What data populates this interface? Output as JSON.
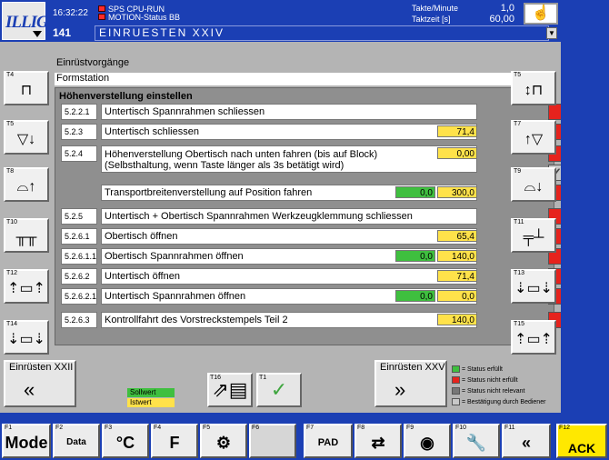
{
  "header": {
    "logo": "ILLIG",
    "time": "16:32:22",
    "sps_label": "SPS CPU-RUN",
    "motion_label": "MOTION-Status BB",
    "takte_label": "Takte/Minute",
    "takte_value": "1,0",
    "taktzeit_label": "Taktzeit [s]",
    "taktzeit_value": "60,00",
    "step_number": "141",
    "step_title": "EINRUESTEN XXIV"
  },
  "main": {
    "title": "Einrüstvorgänge",
    "section": "Formstation",
    "panel_title": "Höhenverstellung einstellen",
    "rows": [
      {
        "code": "5.2.2.1",
        "desc": "Untertisch Spannrahmen schliessen",
        "soll": "",
        "ist": "",
        "status": "red"
      },
      {
        "code": "5.2.3",
        "desc": "Untertisch schliessen",
        "soll": "",
        "ist": "71,4",
        "status": "red"
      },
      {
        "code": "5.2.4",
        "desc": "Höhenverstellung Obertisch nach unten fahren (bis auf Block)",
        "desc2": "(Selbsthaltung, wenn Taste länger als 3s betätigt wird)",
        "soll": "",
        "ist": "0,00",
        "status": "red",
        "status2": "ok"
      },
      {
        "code": "",
        "desc": "Transportbreitenverstellung auf Position fahren",
        "soll": "0,0",
        "ist": "300,0",
        "status": "red"
      },
      {
        "code": "5.2.5",
        "desc": "Untertisch + Obertisch Spannrahmen Werkzeugklemmung schliessen",
        "soll": "",
        "ist": "",
        "status": "red"
      },
      {
        "code": "5.2.6.1",
        "desc": "Obertisch öffnen",
        "soll": "",
        "ist": "65,4",
        "status": "red"
      },
      {
        "code": "5.2.6.1.1",
        "desc": "Obertisch Spannrahmen öffnen",
        "soll": "0,0",
        "ist": "140,0",
        "status": "red"
      },
      {
        "code": "5.2.6.2",
        "desc": "Untertisch öffnen",
        "soll": "",
        "ist": "71,4",
        "status": "red"
      },
      {
        "code": "5.2.6.2.1",
        "desc": "Untertisch Spannrahmen öffnen",
        "soll": "0,0",
        "ist": "0,0",
        "status": "red"
      },
      {
        "code": "5.2.6.3",
        "desc": "Kontrollfahrt des Vorstreckstempels Teil 2",
        "soll": "",
        "ist": "140,0",
        "status": "red"
      }
    ]
  },
  "side_left": [
    {
      "key": "T4",
      "icon": "form-tool-icon"
    },
    {
      "key": "T5",
      "icon": "lower-table-down-icon"
    },
    {
      "key": "T8",
      "icon": "upper-table-up-icon"
    },
    {
      "key": "T10",
      "icon": "clamp-frame-icon"
    },
    {
      "key": "T12",
      "icon": "frame-open-icon"
    },
    {
      "key": "T14",
      "icon": "frame-close-icon"
    }
  ],
  "side_right": [
    {
      "key": "T5",
      "icon": "height-adjust-icon"
    },
    {
      "key": "T7",
      "icon": "upper-table-up-icon"
    },
    {
      "key": "T9",
      "icon": "table-down-icon"
    },
    {
      "key": "T11",
      "icon": "plug-assist-icon"
    },
    {
      "key": "T13",
      "icon": "frame-lift-icon"
    },
    {
      "key": "T15",
      "icon": "frame-lower-icon"
    }
  ],
  "nav": {
    "prev_label": "Einrüsten XXII",
    "prev_key": "T2",
    "next_label": "Einrüsten XXV",
    "next_key": "T3",
    "t16_key": "T16",
    "t1_key": "T1",
    "sollwert": "Sollwert",
    "istwert": "Istwert"
  },
  "legend": [
    {
      "color": "#3fbf3f",
      "text": "= Status erfüllt"
    },
    {
      "color": "#e6231d",
      "text": "= Status nicht erfüllt"
    },
    {
      "color": "#777777",
      "text": "= Status nicht relevant"
    },
    {
      "color": "#c8c8c8",
      "text": "= Bestätigung durch Bediener"
    }
  ],
  "footer": [
    {
      "key": "F1",
      "label": "Mode"
    },
    {
      "key": "F2",
      "label": "Data"
    },
    {
      "key": "F3",
      "label": "°C"
    },
    {
      "key": "F4",
      "label": "F"
    },
    {
      "key": "F5",
      "label": ""
    },
    {
      "key": "F6",
      "label": ""
    },
    {
      "key": "F7",
      "label": "PAD"
    },
    {
      "key": "F8",
      "label": ""
    },
    {
      "key": "F9",
      "label": ""
    },
    {
      "key": "F10",
      "label": ""
    },
    {
      "key": "F11",
      "label": "«"
    },
    {
      "key": "F12",
      "label": "ACK"
    }
  ]
}
